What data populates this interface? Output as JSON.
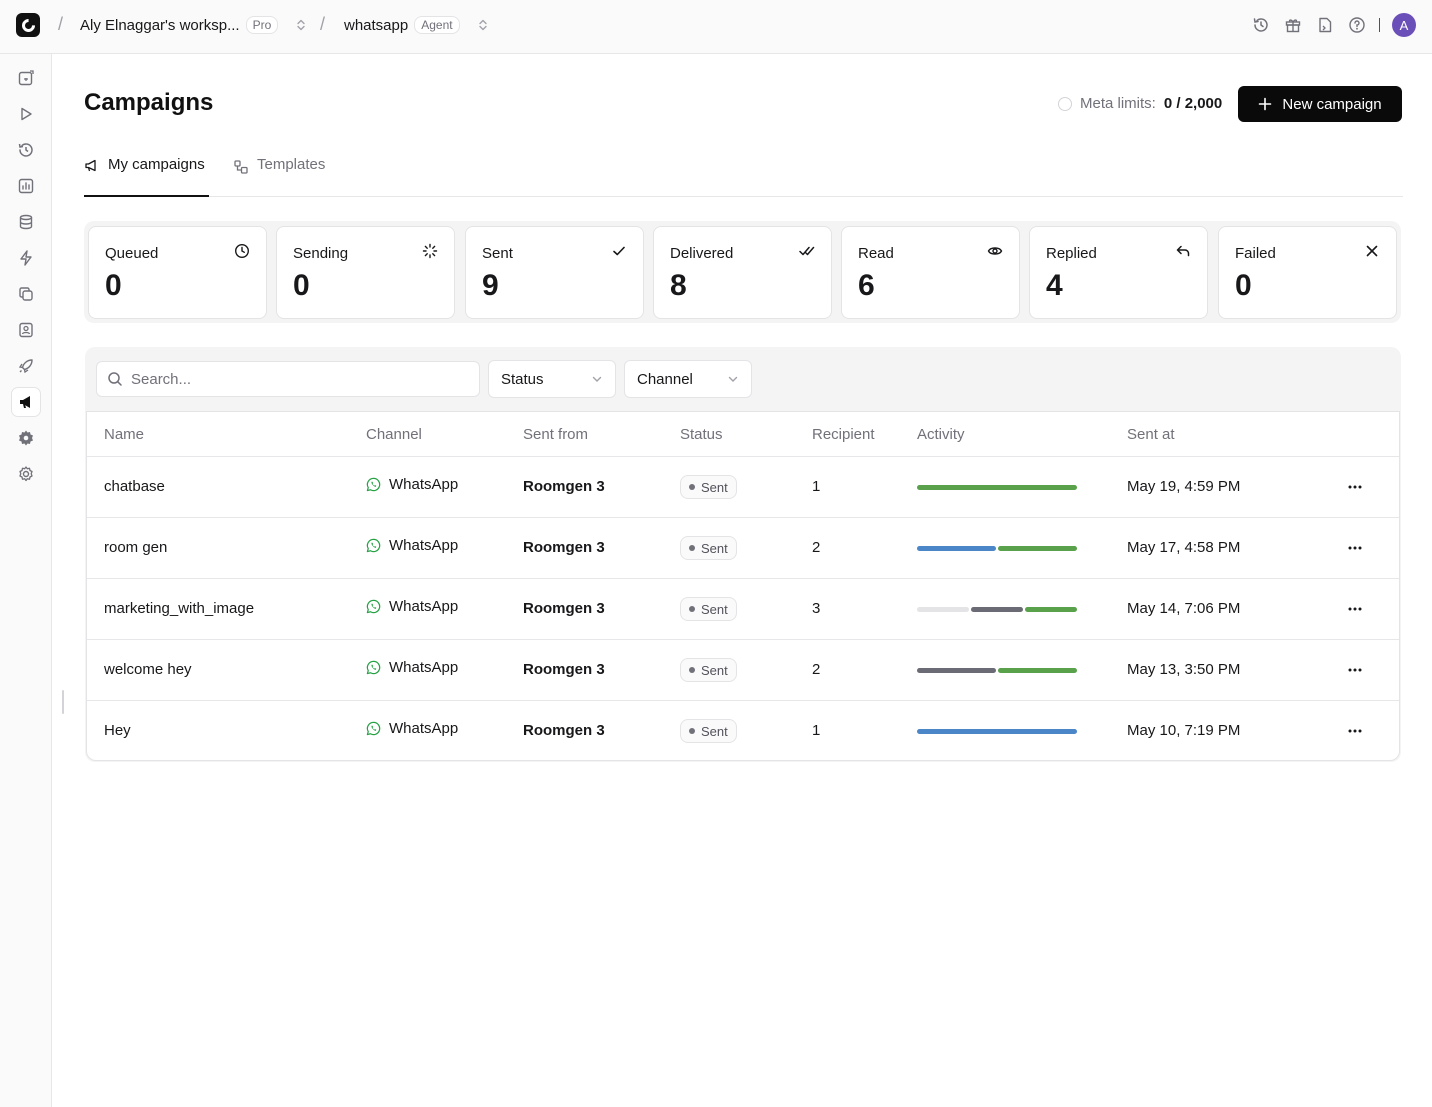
{
  "topbar": {
    "workspace": "Aly Elnaggar's worksp...",
    "workspace_plan": "Pro",
    "project": "whatsapp",
    "project_type": "Agent",
    "avatar_initial": "A"
  },
  "page": {
    "title": "Campaigns",
    "meta_limits_label": "Meta limits:",
    "meta_limits_value": "0 / 2,000",
    "new_campaign_label": "New campaign"
  },
  "tabs": [
    {
      "label": "My campaigns",
      "active": true
    },
    {
      "label": "Templates",
      "active": false
    }
  ],
  "stats": [
    {
      "label": "Queued",
      "value": "0",
      "icon": "clock-icon"
    },
    {
      "label": "Sending",
      "value": "0",
      "icon": "loader-icon"
    },
    {
      "label": "Sent",
      "value": "9",
      "icon": "check-icon"
    },
    {
      "label": "Delivered",
      "value": "8",
      "icon": "double-check-icon"
    },
    {
      "label": "Read",
      "value": "6",
      "icon": "eye-icon"
    },
    {
      "label": "Replied",
      "value": "4",
      "icon": "reply-icon"
    },
    {
      "label": "Failed",
      "value": "0",
      "icon": "x-icon"
    }
  ],
  "filters": {
    "search_placeholder": "Search...",
    "status_label": "Status",
    "channel_label": "Channel"
  },
  "table": {
    "columns": [
      "Name",
      "Channel",
      "Sent from",
      "Status",
      "Recipient",
      "Activity",
      "Sent at"
    ],
    "rows": [
      {
        "name": "chatbase",
        "channel": "WhatsApp",
        "sent_from": "Roomgen 3",
        "status": "Sent",
        "recipient": "1",
        "sent_at": "May 19, 4:59 PM",
        "activity": [
          {
            "share": 1,
            "color": "#5aa14b"
          }
        ]
      },
      {
        "name": "room gen",
        "channel": "WhatsApp",
        "sent_from": "Roomgen 3",
        "status": "Sent",
        "recipient": "2",
        "sent_at": "May 17, 4:58 PM",
        "activity": [
          {
            "share": 0.5,
            "color": "#4a86c8"
          },
          {
            "share": 0.5,
            "color": "#5aa14b"
          }
        ]
      },
      {
        "name": "marketing_with_image",
        "channel": "WhatsApp",
        "sent_from": "Roomgen 3",
        "status": "Sent",
        "recipient": "3",
        "sent_at": "May 14, 7:06 PM",
        "activity": [
          {
            "share": 0.333,
            "color": "#e4e4e7"
          },
          {
            "share": 0.333,
            "color": "#6b6b75"
          },
          {
            "share": 0.334,
            "color": "#5aa14b"
          }
        ]
      },
      {
        "name": "welcome hey",
        "channel": "WhatsApp",
        "sent_from": "Roomgen 3",
        "status": "Sent",
        "recipient": "2",
        "sent_at": "May 13, 3:50 PM",
        "activity": [
          {
            "share": 0.5,
            "color": "#6b6b75"
          },
          {
            "share": 0.5,
            "color": "#5aa14b"
          }
        ]
      },
      {
        "name": "Hey",
        "channel": "WhatsApp",
        "sent_from": "Roomgen 3",
        "status": "Sent",
        "recipient": "1",
        "sent_at": "May 10, 7:19 PM",
        "activity": [
          {
            "share": 1,
            "color": "#4a86c8"
          }
        ]
      }
    ]
  },
  "colors": {
    "whatsapp_green": "#25a244",
    "primary": "#0a0a0a"
  }
}
